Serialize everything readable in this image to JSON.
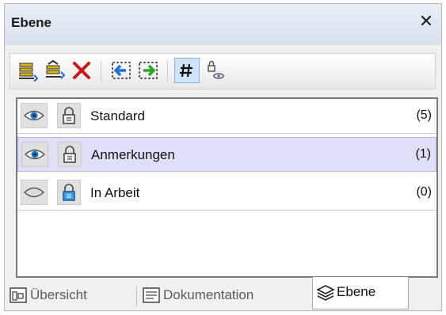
{
  "panel": {
    "title": "Ebene",
    "close_glyph": "✕"
  },
  "toolbar": {
    "buttons": [
      {
        "icon": "new-layer-icon"
      },
      {
        "icon": "new-layer-above-icon"
      },
      {
        "icon": "delete-layer-icon"
      },
      {
        "icon": "move-layer-left-icon"
      },
      {
        "icon": "move-layer-right-icon"
      },
      {
        "icon": "grid-toggle-icon",
        "active": true
      },
      {
        "icon": "lock-visibility-icon"
      }
    ]
  },
  "layers": [
    {
      "name": "Standard",
      "count": "(5)",
      "visible": true,
      "locked": false,
      "selected": false
    },
    {
      "name": "Anmerkungen",
      "count": "(1)",
      "visible": true,
      "locked": false,
      "selected": true
    },
    {
      "name": "In Arbeit",
      "count": "(0)",
      "visible": false,
      "locked": true,
      "selected": false
    }
  ],
  "tabs": [
    {
      "label": "Übersicht",
      "icon": "overview-icon",
      "active": false
    },
    {
      "label": "Dokumentation",
      "icon": "documentation-icon",
      "active": false
    },
    {
      "label": "Ebene",
      "icon": "layers-icon",
      "active": true
    }
  ],
  "colors": {
    "accent": "#1e6fd9",
    "selection": "#dfe0f8",
    "delete": "#d0161d",
    "forward": "#2aa62a"
  }
}
